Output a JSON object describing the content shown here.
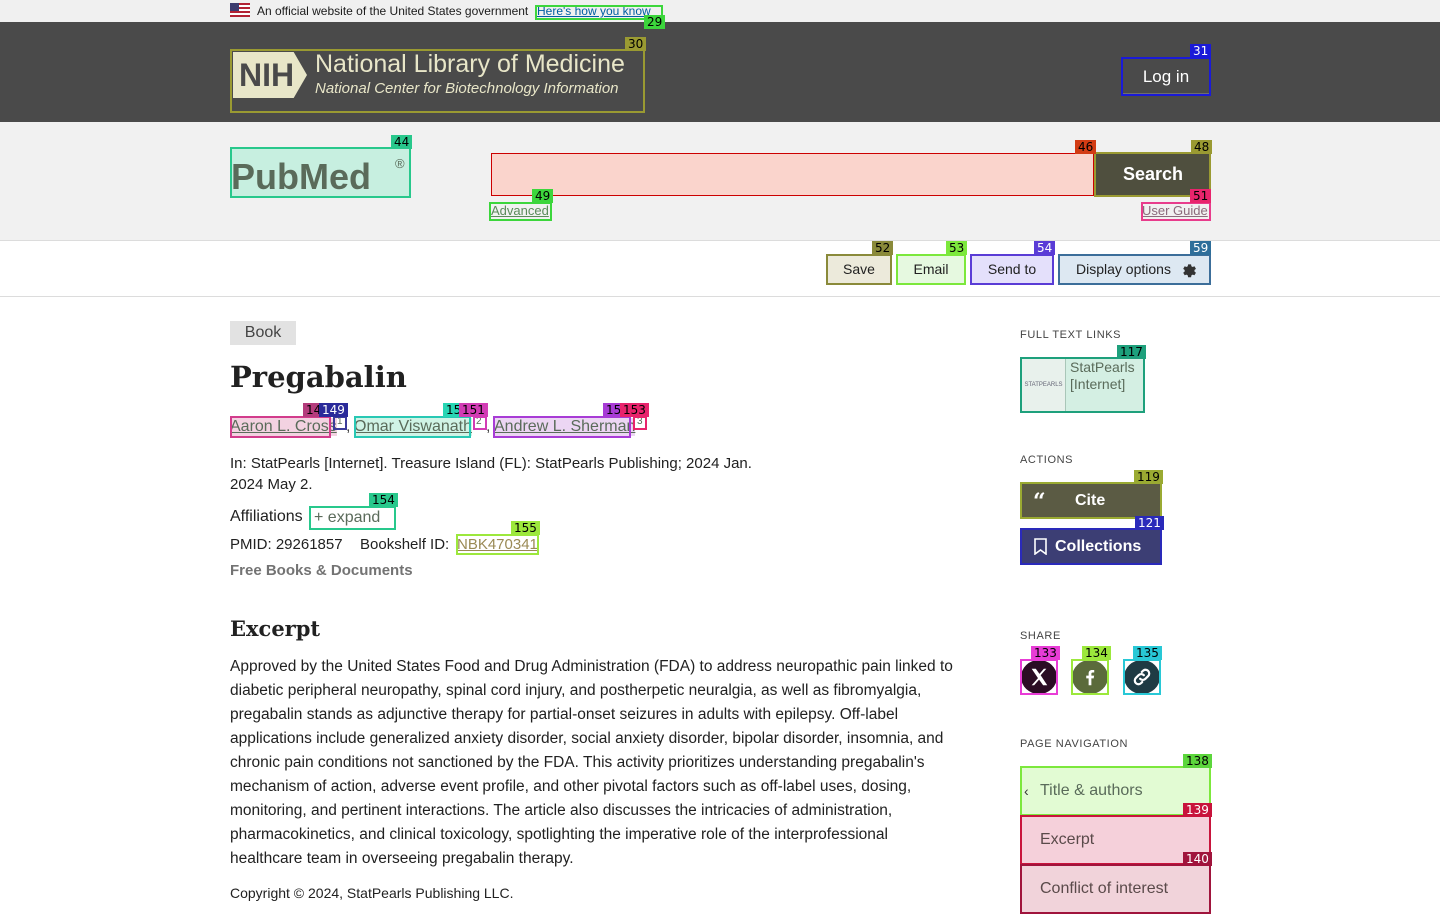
{
  "gov_banner": {
    "text": "An official website of the United States government",
    "link": "Here's how you know"
  },
  "nih": {
    "badge": "NIH",
    "title": "National Library of Medicine",
    "subtitle": "National Center for Biotechnology Information",
    "login_label": "Log in"
  },
  "search": {
    "logo_text": "PubMed",
    "logo_mark": "®",
    "input_value": "",
    "button_label": "Search",
    "advanced_label": "Advanced",
    "user_guide_label": "User Guide"
  },
  "actions_bar": {
    "save": "Save",
    "email": "Email",
    "send_to": "Send to",
    "display_options": "Display options"
  },
  "article": {
    "type": "Book",
    "title": "Pregabalin",
    "authors": [
      {
        "name": "Aaron L. Cross",
        "sup": "1"
      },
      {
        "name": "Omar Viswanath",
        "sup": "2"
      },
      {
        "name": "Andrew L. Sherman",
        "sup": "3"
      }
    ],
    "citation": "In: StatPearls [Internet]. Treasure Island (FL): StatPearls Publishing; 2024 Jan. 2024 May 2.",
    "affiliations_label": "Affiliations",
    "expand_label": "expand",
    "pmid": "PMID: 29261857",
    "bookshelf_label": "Bookshelf ID:",
    "bookshelf_id": "NBK470341",
    "collection": "Free Books & Documents",
    "excerpt_heading": "Excerpt",
    "excerpt": "Approved by the United States Food and Drug Administration (FDA) to address neuropathic pain linked to diabetic peripheral neuropathy, spinal cord injury, and postherpetic neuralgia, as well as fibromyalgia, pregabalin stands as adjunctive therapy for partial-onset seizures in adults with epilepsy. Off-label applications include generalized anxiety disorder, social anxiety disorder, bipolar disorder, insomnia, and chronic pain conditions not sanctioned by the FDA. This activity prioritizes understanding pregabalin's mechanism of action, adverse event profile, and other pivotal factors such as off-label uses, dosing, monitoring, and pertinent interactions. The article also discusses the intricacies of administration, pharmacokinetics, and clinical toxicology, spotlighting the imperative role of the interprofessional healthcare team in overseeing pregabalin therapy.",
    "copyright": "Copyright © 2024, StatPearls Publishing LLC."
  },
  "sidebar": {
    "full_text_label": "FULL TEXT LINKS",
    "statpearls_logo": "STATPEARLS",
    "statpearls_label": "StatPearls [Internet]",
    "actions_label": "ACTIONS",
    "cite_label": "Cite",
    "collections_label": "Collections",
    "share_label": "SHARE",
    "page_nav_label": "PAGE NAVIGATION",
    "nav": [
      "Title & authors",
      "Excerpt",
      "Conflict of interest"
    ]
  },
  "annotations": {
    "gov_link": "29",
    "nih_logo": "30",
    "login": "31",
    "pubmed_logo": "44",
    "search_input": "46",
    "search_btn": "48",
    "advanced": "49",
    "user_guide": "51",
    "save": "52",
    "email": "53",
    "send_to": "54",
    "display": "59",
    "author1_a": "148",
    "author1_b": "149",
    "author2_a": "150",
    "author2_b": "151",
    "author3_a": "152",
    "author3_b": "153",
    "expand": "154",
    "nbk": "155",
    "statpearls": "117",
    "cite": "119",
    "collections": "121",
    "share_x": "133",
    "share_fb": "134",
    "share_link": "135",
    "nav1": "138",
    "nav2": "139",
    "nav3": "140"
  },
  "colors": {
    "nih_bg": "#4a4a4a",
    "search_btn": "#4f4f3e",
    "cite_btn": "#5b5b44",
    "collections_btn": "#3c3e74"
  }
}
